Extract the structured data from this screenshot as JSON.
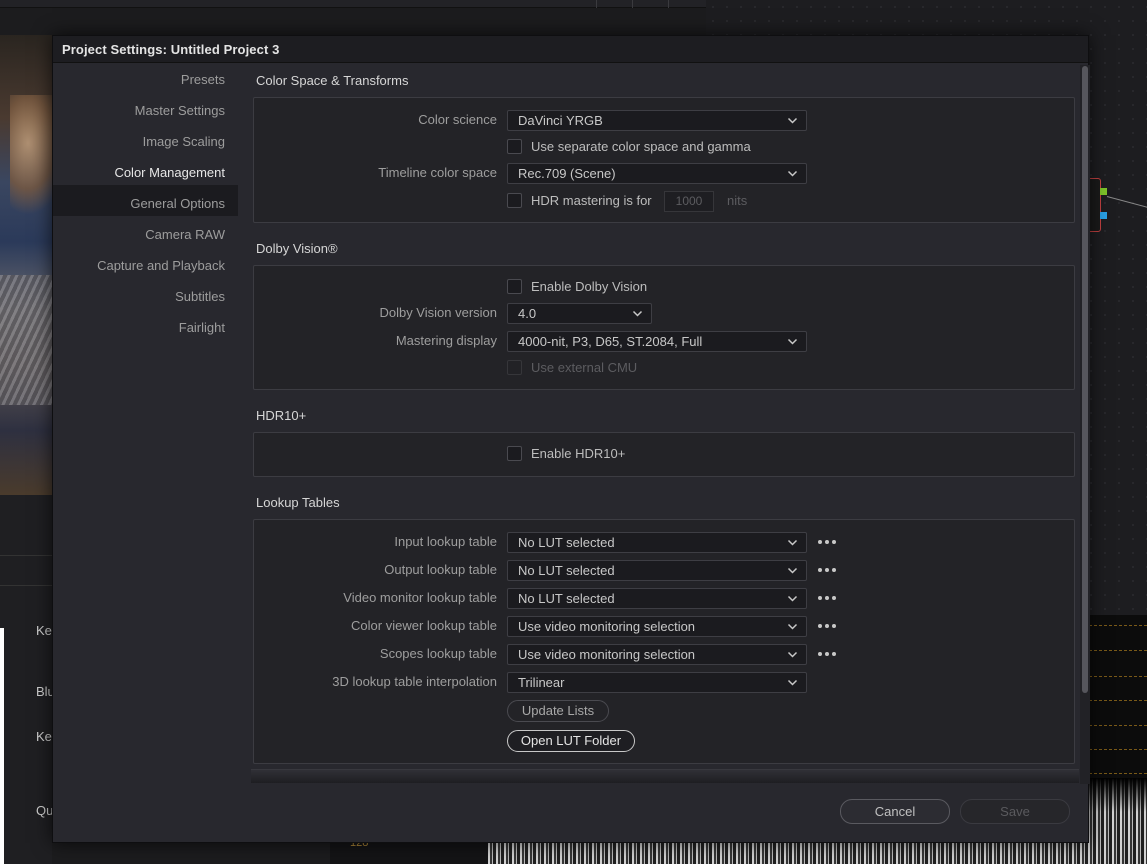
{
  "dialog": {
    "title": "Project Settings:  Untitled Project 3",
    "cancel_label": "Cancel",
    "save_label": "Save"
  },
  "nav": {
    "items": [
      {
        "label": "Presets",
        "active": false
      },
      {
        "label": "Master Settings",
        "active": false
      },
      {
        "label": "Image Scaling",
        "active": false
      },
      {
        "label": "Color Management",
        "active": true
      },
      {
        "label": "General Options",
        "active": false
      },
      {
        "label": "Camera RAW",
        "active": false
      },
      {
        "label": "Capture and Playback",
        "active": false
      },
      {
        "label": "Subtitles",
        "active": false
      },
      {
        "label": "Fairlight",
        "active": false
      }
    ]
  },
  "color_space": {
    "title": "Color Space & Transforms",
    "color_science_label": "Color science",
    "color_science_value": "DaVinci YRGB",
    "separate_label": "Use separate color space and gamma",
    "timeline_label": "Timeline color space",
    "timeline_value": "Rec.709 (Scene)",
    "hdr_label": "HDR mastering is for",
    "hdr_nits_value": "1000",
    "hdr_nits_unit": "nits"
  },
  "dolby": {
    "title": "Dolby Vision®",
    "enable_label": "Enable Dolby Vision",
    "version_label": "Dolby Vision version",
    "version_value": "4.0",
    "mastering_label": "Mastering display",
    "mastering_value": "4000-nit, P3, D65, ST.2084, Full",
    "external_cmu_label": "Use external CMU"
  },
  "hdr10": {
    "title": "HDR10+",
    "enable_label": "Enable HDR10+"
  },
  "lut": {
    "title": "Lookup Tables",
    "rows": [
      {
        "label": "Input lookup table",
        "value": "No LUT selected"
      },
      {
        "label": "Output lookup table",
        "value": "No LUT selected"
      },
      {
        "label": "Video monitor lookup table",
        "value": "No LUT selected"
      },
      {
        "label": "Color viewer lookup table",
        "value": "Use video monitoring selection"
      },
      {
        "label": "Scopes lookup table",
        "value": "Use video monitoring selection"
      }
    ],
    "interp_label": "3D lookup table interpolation",
    "interp_value": "Trilinear",
    "update_label": "Update Lists",
    "open_folder_label": "Open LUT Folder"
  },
  "background": {
    "left_labels": [
      "Ke",
      "Blu",
      "Ke",
      "Qu"
    ],
    "scope_value": "128"
  }
}
